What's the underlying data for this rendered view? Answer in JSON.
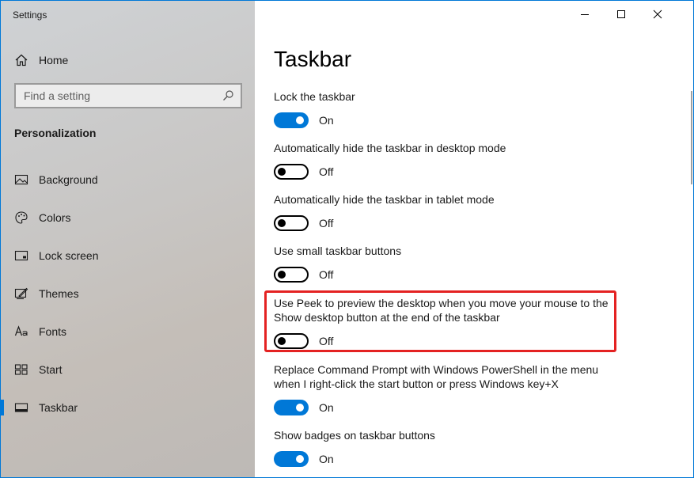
{
  "window": {
    "title": "Settings"
  },
  "sidebar": {
    "home_label": "Home",
    "search_placeholder": "Find a setting",
    "section_title": "Personalization",
    "items": [
      {
        "label": "Background",
        "icon": "picture-icon"
      },
      {
        "label": "Colors",
        "icon": "palette-icon"
      },
      {
        "label": "Lock screen",
        "icon": "lock-screen-icon"
      },
      {
        "label": "Themes",
        "icon": "themes-icon"
      },
      {
        "label": "Fonts",
        "icon": "font-icon"
      },
      {
        "label": "Start",
        "icon": "start-grid-icon"
      },
      {
        "label": "Taskbar",
        "icon": "taskbar-icon",
        "active": true
      }
    ]
  },
  "main": {
    "title": "Taskbar",
    "settings": [
      {
        "label": "Lock the taskbar",
        "state": "On"
      },
      {
        "label": "Automatically hide the taskbar in desktop mode",
        "state": "Off"
      },
      {
        "label": "Automatically hide the taskbar in tablet mode",
        "state": "Off"
      },
      {
        "label": "Use small taskbar buttons",
        "state": "Off"
      },
      {
        "label": "Use Peek to preview the desktop when you move your mouse to the Show desktop button at the end of the taskbar",
        "state": "Off",
        "highlighted": true
      },
      {
        "label": "Replace Command Prompt with Windows PowerShell in the menu when I right-click the start button or press Windows key+X",
        "state": "On"
      },
      {
        "label": "Show badges on taskbar buttons",
        "state": "On"
      }
    ]
  },
  "colors": {
    "accent": "#0078d7",
    "highlight": "#e42222"
  }
}
